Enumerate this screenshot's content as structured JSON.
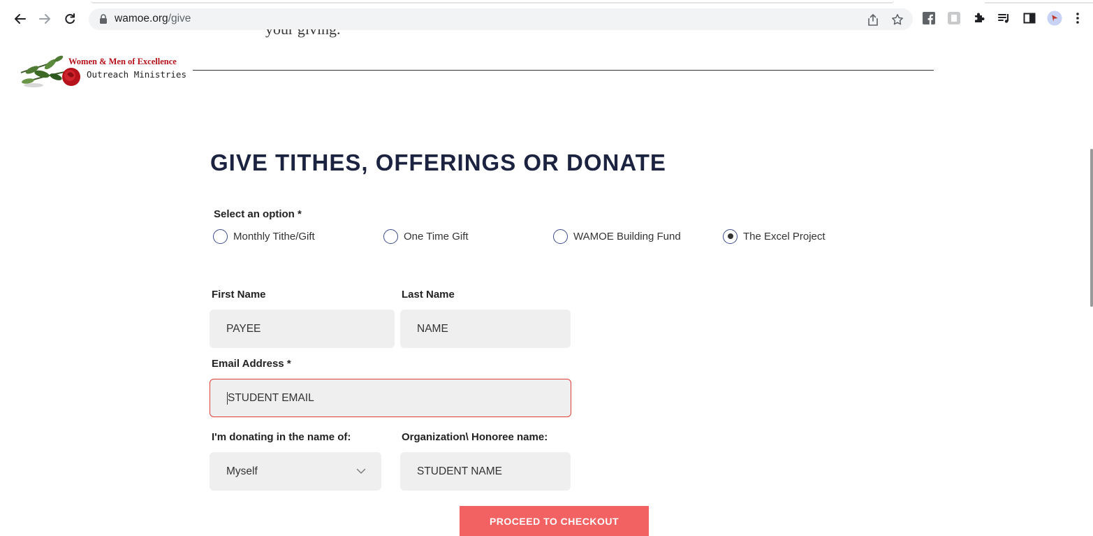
{
  "browser": {
    "url_host": "wamoe.org",
    "url_path": "/give"
  },
  "page": {
    "clipped_text": "your giving.",
    "logo": {
      "line1": "Women & Men of Excellence",
      "line2": "Outreach Ministries"
    },
    "title": "GIVE TITHES, OFFERINGS OR DONATE"
  },
  "form": {
    "select_label": "Select an option *",
    "options": [
      {
        "label": "Monthly Tithe/Gift",
        "selected": false
      },
      {
        "label": "One Time Gift",
        "selected": false
      },
      {
        "label": "WAMOE Building Fund",
        "selected": false
      },
      {
        "label": "The Excel Project",
        "selected": true
      }
    ],
    "first_name": {
      "label": "First Name",
      "value": "PAYEE"
    },
    "last_name": {
      "label": "Last Name",
      "value": "NAME"
    },
    "email": {
      "label": "Email Address *",
      "value": "STUDENT EMAIL"
    },
    "donating_for": {
      "label": "I'm donating in the name of:",
      "value": "Myself"
    },
    "honoree": {
      "label": "Organization\\ Honoree name:",
      "value": "STUDENT NAME"
    },
    "submit_label": "PROCEED TO CHECKOUT"
  },
  "colors": {
    "title": "#1c2340",
    "button": "#f26262",
    "error_border": "#e0403a",
    "logo_red": "#b5121b"
  }
}
